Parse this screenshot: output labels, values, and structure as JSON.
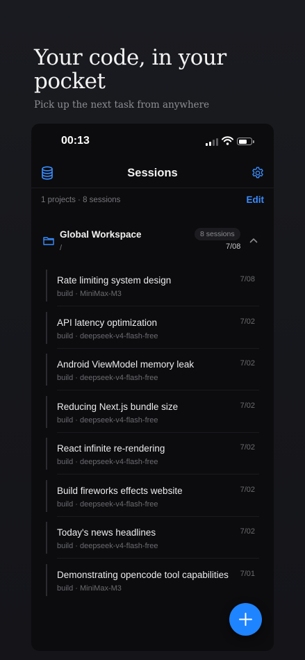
{
  "hero": {
    "title": "Your code, in your pocket",
    "subtitle": "Pick up the next task from anywhere"
  },
  "status_bar": {
    "time": "00:13"
  },
  "nav": {
    "title": "Sessions",
    "left_icon": "database-icon",
    "right_icon": "gear-icon"
  },
  "summary": {
    "text": "1 projects · 8 sessions",
    "edit_label": "Edit"
  },
  "group": {
    "name": "Global Workspace",
    "path": "/",
    "badge": "8 sessions",
    "date": "7/08"
  },
  "sessions": [
    {
      "title": "Rate limiting system design",
      "meta": "build · MiniMax-M3",
      "date": "7/08"
    },
    {
      "title": "API latency optimization",
      "meta": "build · deepseek-v4-flash-free",
      "date": "7/02"
    },
    {
      "title": "Android ViewModel memory leak",
      "meta": "build · deepseek-v4-flash-free",
      "date": "7/02"
    },
    {
      "title": "Reducing Next.js bundle size",
      "meta": "build · deepseek-v4-flash-free",
      "date": "7/02"
    },
    {
      "title": "React infinite re-rendering",
      "meta": "build · deepseek-v4-flash-free",
      "date": "7/02"
    },
    {
      "title": "Build fireworks effects website",
      "meta": "build · deepseek-v4-flash-free",
      "date": "7/02"
    },
    {
      "title": "Today's news headlines",
      "meta": "build · deepseek-v4-flash-free",
      "date": "7/02"
    },
    {
      "title": "Demonstrating opencode tool capabilities",
      "meta": "build · MiniMax-M3",
      "date": "7/01"
    }
  ],
  "colors": {
    "accent": "#3a8dff",
    "fab": "#1f84ff",
    "background": "#17181c",
    "panel": "#0c0c0e"
  },
  "fab": {
    "icon": "plus-icon"
  }
}
